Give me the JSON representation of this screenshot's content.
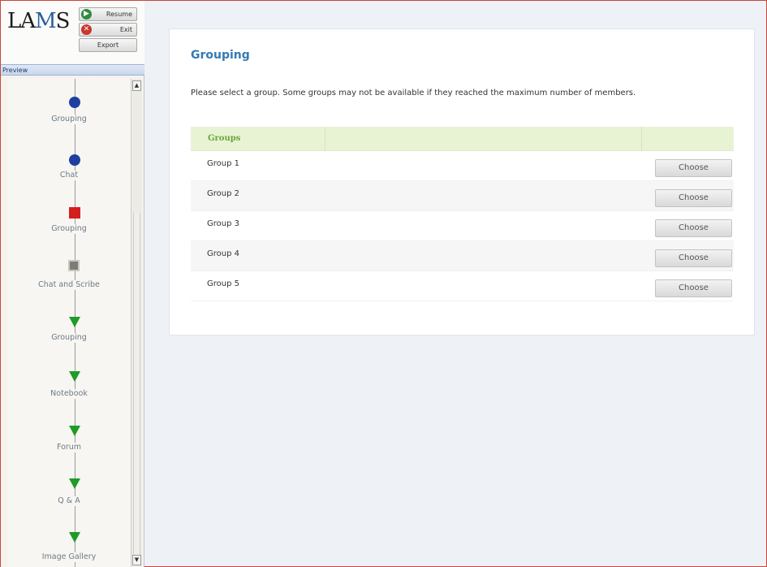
{
  "logo": {
    "text_prefix": "LA",
    "text_m": "M",
    "text_suffix": "S"
  },
  "controls": {
    "resume": "Resume",
    "exit": "Exit",
    "export": "Export"
  },
  "preview_label": "Preview",
  "sequence": [
    {
      "label": "Grouping",
      "status": "completed",
      "icon": "blue-circle"
    },
    {
      "label": "Chat",
      "status": "completed",
      "icon": "blue-circle"
    },
    {
      "label": "Grouping",
      "status": "current",
      "icon": "red-square"
    },
    {
      "label": "Chat and Scribe",
      "status": "not-attempted",
      "icon": "gray-square"
    },
    {
      "label": "Grouping",
      "status": "not-attempted",
      "icon": "green-triangle"
    },
    {
      "label": "Notebook",
      "status": "not-attempted",
      "icon": "green-triangle"
    },
    {
      "label": "Forum",
      "status": "not-attempted",
      "icon": "green-triangle"
    },
    {
      "label": "Q & A",
      "status": "not-attempted",
      "icon": "green-triangle"
    },
    {
      "label": "Image Gallery",
      "status": "not-attempted",
      "icon": "green-triangle"
    }
  ],
  "main": {
    "title": "Grouping",
    "intro": "Please select a group. Some groups may not be available if they reached the maximum number of members.",
    "table_header": "Groups",
    "groups": [
      {
        "name": "Group 1",
        "button": "Choose"
      },
      {
        "name": "Group 2",
        "button": "Choose"
      },
      {
        "name": "Group 3",
        "button": "Choose"
      },
      {
        "name": "Group 4",
        "button": "Choose"
      },
      {
        "name": "Group 5",
        "button": "Choose"
      }
    ]
  },
  "colors": {
    "accent_title": "#3579b4",
    "header_green": "#6aa53a",
    "completed": "#1f3fa0",
    "current": "#d41f1f",
    "todo": "#1f9b27"
  }
}
